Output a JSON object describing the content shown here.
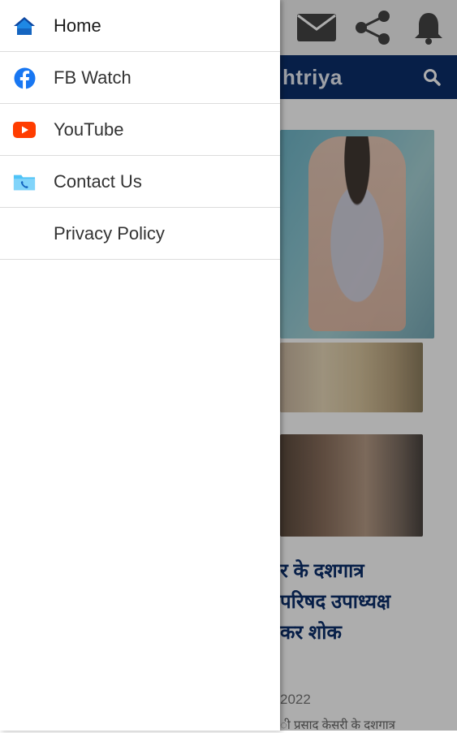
{
  "app": {
    "title_partial": "htriya",
    "headline_lines": [
      "र के दशगात्र",
      "परिषद उपाध्यक्ष",
      "कर शोक"
    ],
    "date_partial": "2022",
    "snippet_partial": "ी प्रसाद केसरी के दशगात्र"
  },
  "toolbar": {
    "icons": [
      "mail-icon",
      "share-icon",
      "bell-icon"
    ]
  },
  "drawer": {
    "items": [
      {
        "label": "Home",
        "icon": "home-icon",
        "color": "#1565c0"
      },
      {
        "label": "FB Watch",
        "icon": "facebook-icon",
        "color": "#1877f2"
      },
      {
        "label": "YouTube",
        "icon": "youtube-icon",
        "color": "#ff3d00"
      },
      {
        "label": "Contact Us",
        "icon": "contact-folder-icon",
        "color": "#4fc3f7"
      },
      {
        "label": "Privacy Policy",
        "icon": "",
        "color": ""
      }
    ]
  },
  "colors": {
    "title_bar": "#0b2e6b",
    "scrim": "rgba(0,0,0,0.32)"
  }
}
